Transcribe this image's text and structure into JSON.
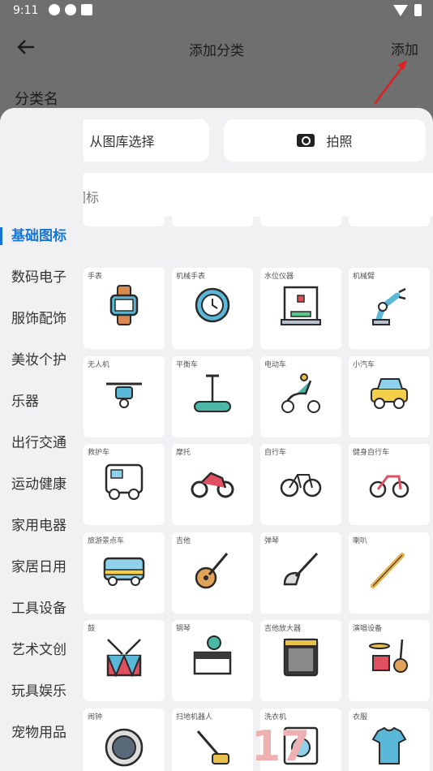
{
  "status": {
    "time": "9:11"
  },
  "appbar": {
    "title": "添加分类",
    "add": "添加"
  },
  "form": {
    "field_label": "分类名"
  },
  "sheet": {
    "gallery_label": "从图库选择",
    "camera_label": "拍照",
    "search_placeholder": "搜索图标"
  },
  "categories": [
    "基础图标",
    "数码电子",
    "服饰配饰",
    "美妆个护",
    "乐器",
    "出行交通",
    "运动健康",
    "家用电器",
    "家居日用",
    "工具设备",
    "艺术文创",
    "玩具娱乐",
    "宠物用品"
  ],
  "tiles": [
    {
      "label": "",
      "icon": "projector-icon"
    },
    {
      "label": "",
      "icon": "mixer-icon"
    },
    {
      "label": "",
      "icon": "headset-icon"
    },
    {
      "label": "",
      "icon": "server-icon"
    },
    {
      "label": "手表",
      "icon": "watch-icon"
    },
    {
      "label": "机械手表",
      "icon": "mechanical-watch-icon"
    },
    {
      "label": "水位仪器",
      "icon": "3d-printer-icon"
    },
    {
      "label": "机械臂",
      "icon": "robot-arm-icon"
    },
    {
      "label": "无人机",
      "icon": "drone-icon"
    },
    {
      "label": "平衡车",
      "icon": "balance-scooter-icon"
    },
    {
      "label": "电动车",
      "icon": "electric-scooter-icon"
    },
    {
      "label": "小汽车",
      "icon": "car-icon"
    },
    {
      "label": "救护车",
      "icon": "camper-van-icon"
    },
    {
      "label": "摩托",
      "icon": "motorcycle-icon"
    },
    {
      "label": "自行车",
      "icon": "bicycle-icon"
    },
    {
      "label": "健身自行车",
      "icon": "kids-bike-icon"
    },
    {
      "label": "旅游景点车",
      "icon": "bus-icon"
    },
    {
      "label": "吉他",
      "icon": "guitar-icon"
    },
    {
      "label": "弹琴",
      "icon": "electric-guitar-icon"
    },
    {
      "label": "喇叭",
      "icon": "flute-icon"
    },
    {
      "label": "鼓",
      "icon": "drum-icon"
    },
    {
      "label": "钢琴",
      "icon": "piano-icon"
    },
    {
      "label": "吉他放大器",
      "icon": "amplifier-icon"
    },
    {
      "label": "演唱设备",
      "icon": "band-instruments-icon"
    },
    {
      "label": "闹钟",
      "icon": "robot-vacuum-icon"
    },
    {
      "label": "扫地机器人",
      "icon": "floor-cleaner-icon"
    },
    {
      "label": "洗衣机",
      "icon": "washing-machine-icon"
    },
    {
      "label": "衣服",
      "icon": "clothes-icon"
    }
  ],
  "overlay": {
    "number": "17"
  },
  "colors": {
    "accent": "#1576d6",
    "arrow": "#e02020"
  }
}
